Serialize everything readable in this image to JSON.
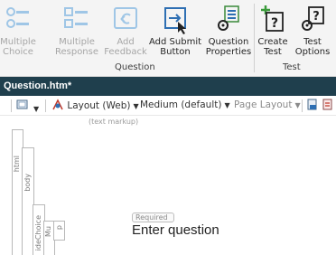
{
  "ribbon": {
    "buttons": [
      {
        "id": "multiple-choice",
        "label": "Multiple\nChoice",
        "icon": "multiple-choice-icon",
        "enabled": false
      },
      {
        "id": "multiple-response",
        "label": "Multiple\nResponse",
        "icon": "multiple-response-icon",
        "enabled": false
      },
      {
        "id": "add-feedback",
        "label": "Add\nFeedback",
        "icon": "add-feedback-icon",
        "enabled": false
      },
      {
        "id": "add-submit-button",
        "label": "Add Submit\nButton",
        "icon": "add-submit-icon",
        "enabled": true
      },
      {
        "id": "question-properties",
        "label": "Question\nProperties",
        "icon": "question-properties-icon",
        "enabled": true
      },
      {
        "id": "create-test",
        "label": "Create\nTest",
        "icon": "create-test-icon",
        "enabled": true
      },
      {
        "id": "test-options",
        "label": "Test\nOptions",
        "icon": "test-options-icon",
        "enabled": true
      }
    ],
    "groups": {
      "question": "Question",
      "test": "Test"
    }
  },
  "document": {
    "title": "Question.htm*"
  },
  "toolbar": {
    "layout": "Layout (Web)",
    "medium": "Medium (default)",
    "page_layout": "Page Layout"
  },
  "editor": {
    "markup_hint": "(text markup)",
    "tags": {
      "html": "html",
      "body": "body",
      "choice": "ideChoice",
      "mu": "Mu",
      "p": "p"
    },
    "required_badge": "Required",
    "question_placeholder": "Enter question"
  },
  "colors": {
    "title_bar": "#1f3f4d",
    "accent_blue": "#2e6fb3",
    "green_plus": "#3a9a3a"
  }
}
